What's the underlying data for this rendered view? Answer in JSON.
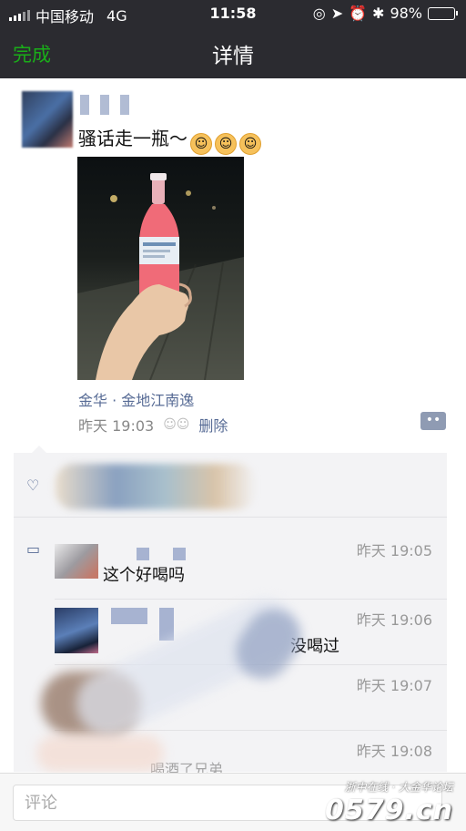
{
  "status_bar": {
    "carrier": "中国移动",
    "network": "4G",
    "time": "11:58",
    "battery_percent": "98%",
    "battery_level": 0.98,
    "battery_color": "#f5c300"
  },
  "nav": {
    "done_label": "完成",
    "title": "详情"
  },
  "post": {
    "text": "骚话走一瓶～",
    "emoji_icon": "smiling-face-icon",
    "location": "金华 · 金地江南逸",
    "time": "昨天 19:03",
    "delete_label": "删除"
  },
  "comments": [
    {
      "time": "昨天 19:05",
      "text": "这个好喝吗"
    },
    {
      "time": "昨天 19:06",
      "text": "没喝过"
    },
    {
      "time": "昨天 19:07",
      "text": ""
    },
    {
      "time": "昨天 19:08",
      "text": "喝酒了兄弟"
    }
  ],
  "input": {
    "placeholder": "评论"
  },
  "watermark": {
    "line1": "浙中在线 · 大金华论坛",
    "line2": "0579.cn"
  },
  "colors": {
    "nav_bg": "#2b2b30",
    "accent_green": "#1aad19",
    "link_blue": "#576b95"
  }
}
